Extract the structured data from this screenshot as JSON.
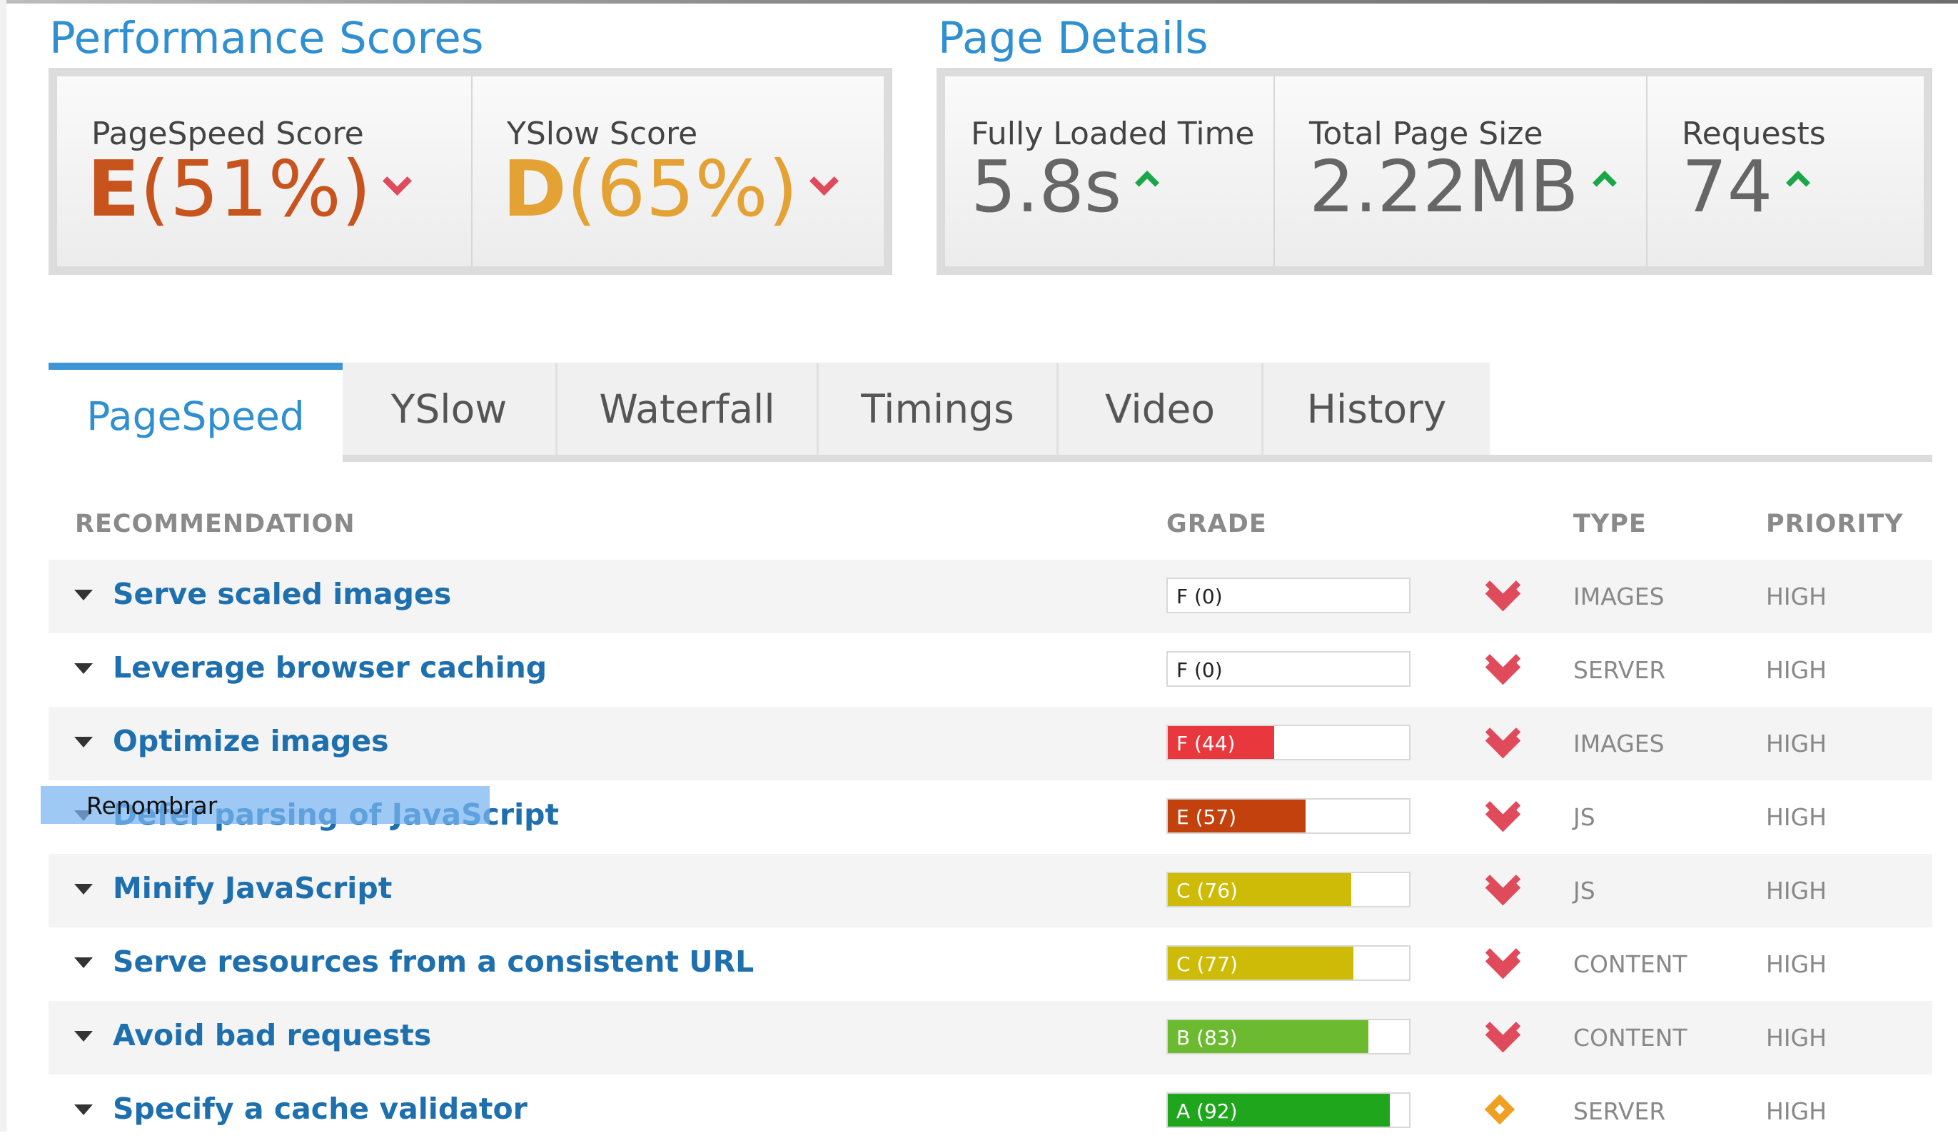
{
  "performance": {
    "title": "Performance Scores",
    "pagespeed": {
      "label": "PageSpeed Score",
      "grade": "E",
      "percent": "(51%)",
      "color": "#c8541d"
    },
    "yslow": {
      "label": "YSlow Score",
      "grade": "D",
      "percent": "(65%)",
      "color": "#e3a233"
    }
  },
  "details": {
    "title": "Page Details",
    "loaded": {
      "label": "Fully Loaded Time",
      "value": "5.8s"
    },
    "size": {
      "label": "Total Page Size",
      "value": "2.22MB"
    },
    "requests": {
      "label": "Requests",
      "value": "74"
    }
  },
  "tabs": [
    "PageSpeed",
    "YSlow",
    "Waterfall",
    "Timings",
    "Video",
    "History"
  ],
  "active_tab": "PageSpeed",
  "table": {
    "headers": {
      "recommendation": "RECOMMENDATION",
      "grade": "GRADE",
      "type": "TYPE",
      "priority": "PRIORITY"
    },
    "rows": [
      {
        "rec": "Serve scaled images",
        "grade": "F (0)",
        "score": 0,
        "fill": "#ffffff",
        "type": "IMAGES",
        "priority": "HIGH",
        "trend": "down"
      },
      {
        "rec": "Leverage browser caching",
        "grade": "F (0)",
        "score": 0,
        "fill": "#ffffff",
        "type": "SERVER",
        "priority": "HIGH",
        "trend": "down"
      },
      {
        "rec": "Optimize images",
        "grade": "F (44)",
        "score": 44,
        "fill": "#e8383d",
        "type": "IMAGES",
        "priority": "HIGH",
        "trend": "down"
      },
      {
        "rec": "Defer parsing of JavaScript",
        "grade": "E (57)",
        "score": 57,
        "fill": "#c2410c",
        "type": "JS",
        "priority": "HIGH",
        "trend": "down"
      },
      {
        "rec": "Minify JavaScript",
        "grade": "C (76)",
        "score": 76,
        "fill": "#cdbb08",
        "type": "JS",
        "priority": "HIGH",
        "trend": "down"
      },
      {
        "rec": "Serve resources from a consistent URL",
        "grade": "C (77)",
        "score": 77,
        "fill": "#cdbb08",
        "type": "CONTENT",
        "priority": "HIGH",
        "trend": "down"
      },
      {
        "rec": "Avoid bad requests",
        "grade": "B (83)",
        "score": 83,
        "fill": "#6cba2f",
        "type": "CONTENT",
        "priority": "HIGH",
        "trend": "down"
      },
      {
        "rec": "Specify a cache validator",
        "grade": "A (92)",
        "score": 92,
        "fill": "#1fa61c",
        "type": "SERVER",
        "priority": "HIGH",
        "trend": "neutral"
      }
    ]
  },
  "rename_overlay": {
    "label": "Renombrar"
  },
  "colors": {
    "accent": "#2f8fd0",
    "link": "#1e6fae",
    "down": "#e04b5c",
    "up": "#1aa74a",
    "neutral": "#f0a020"
  }
}
